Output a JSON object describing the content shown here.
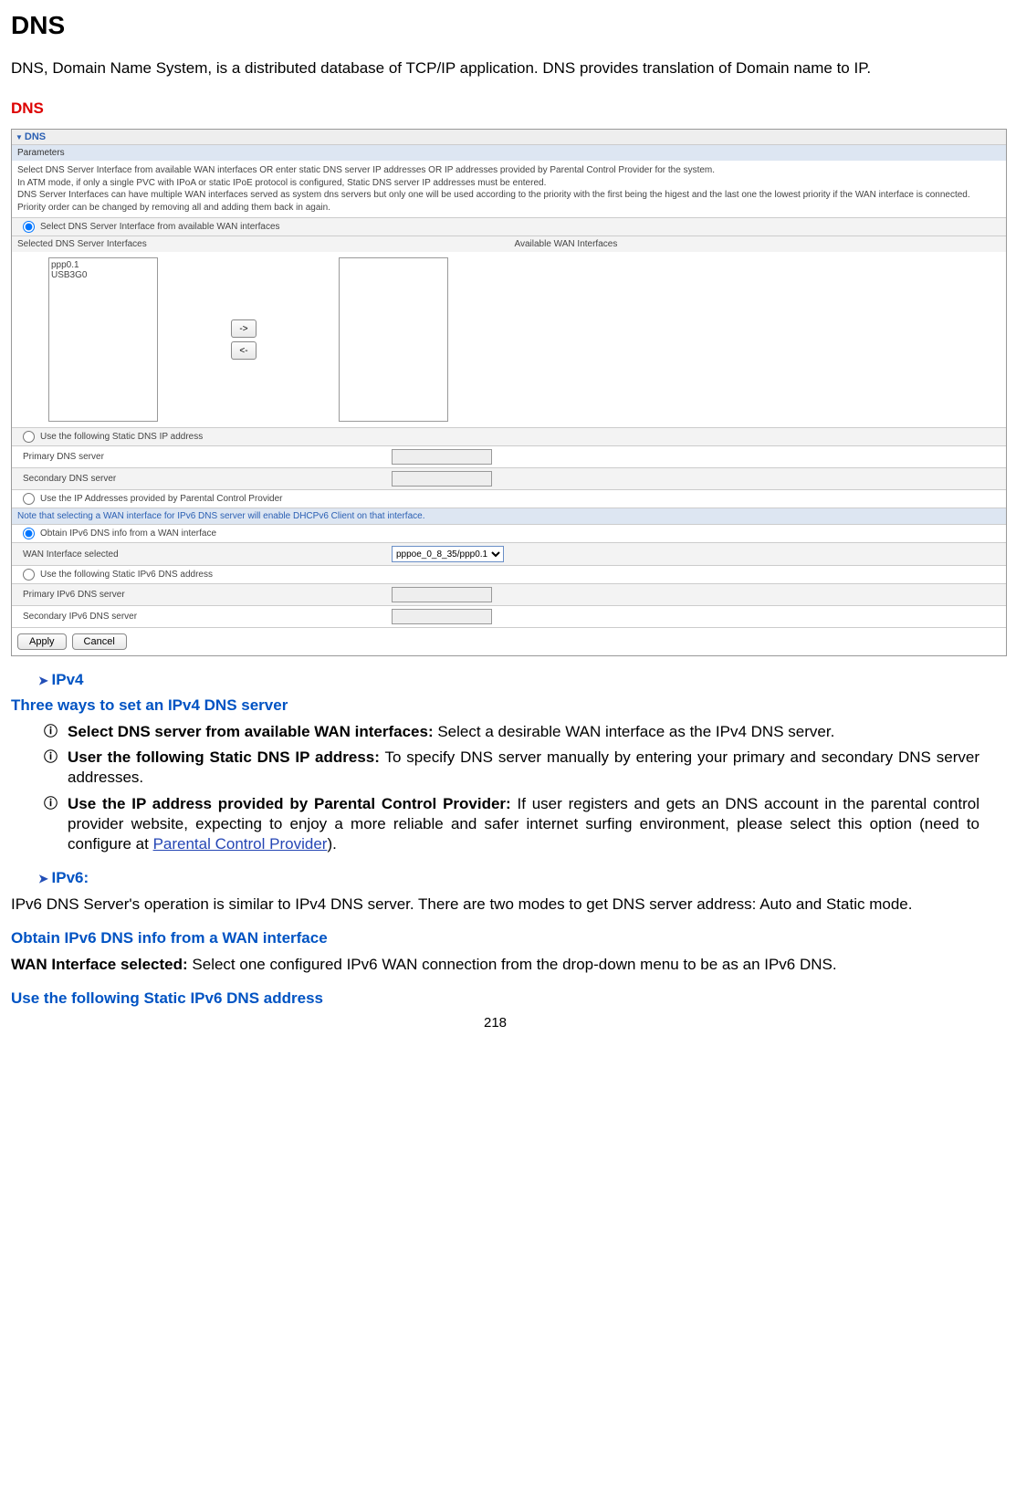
{
  "title": "DNS",
  "intro": "DNS, Domain Name System, is a distributed database of TCP/IP application. DNS provides translation of Domain name to IP.",
  "section_dns": "DNS",
  "panel": {
    "title": "DNS",
    "parameters": "Parameters",
    "desc1": "Select DNS Server Interface from available WAN interfaces OR enter static DNS server IP addresses OR IP addresses provided by Parental Control Provider for the system.",
    "desc2": "In ATM mode, if only a single PVC with IPoA or static IPoE protocol is configured, Static DNS server IP addresses must be entered.",
    "desc3": "DNS Server Interfaces can have multiple WAN interfaces served as system dns servers but only one will be used according to the priority with the first being the higest and the last one the lowest priority if the WAN interface is connected.",
    "desc4": "Priority order can be changed by removing all and adding them back in again.",
    "opt_select_wan": "Select DNS Server Interface from available WAN interfaces",
    "selected_head": "Selected DNS Server Interfaces",
    "available_head": "Available WAN Interfaces",
    "list_item_1": "ppp0.1",
    "list_item_2": "USB3G0",
    "btn_right": "->",
    "btn_left": "<-",
    "opt_static_dns": "Use the following Static DNS IP address",
    "primary_dns": "Primary DNS server",
    "secondary_dns": "Secondary DNS server",
    "opt_parental": "Use the IP Addresses provided by Parental Control Provider",
    "note_ipv6": "Note that selecting a WAN interface for IPv6 DNS server will enable DHCPv6 Client on that interface.",
    "opt_obtain_ipv6": "Obtain IPv6 DNS info from a WAN interface",
    "wan_iface_selected": "WAN Interface selected",
    "wan_select_option": "pppoe_0_8_35/ppp0.1",
    "opt_static_ipv6": "Use the following Static IPv6 DNS address",
    "primary_ipv6": "Primary IPv6 DNS server",
    "secondary_ipv6": "Secondary IPv6 DNS server",
    "btn_apply": "Apply",
    "btn_cancel": "Cancel"
  },
  "ipv4": {
    "head": "IPv4",
    "three_ways": "Three ways to set an IPv4 DNS server",
    "li1_bold": "Select DNS server from available WAN interfaces:",
    "li1_text": " Select a desirable WAN interface as the IPv4 DNS server.",
    "li2_bold": "User the following Static DNS IP address:",
    "li2_text": " To specify DNS server manually by entering your primary and secondary DNS server addresses.",
    "li3_bold": "Use the IP address provided by Parental Control Provider:",
    "li3_text_a": " If user registers and gets an DNS account in the parental control provider website, expecting to enjoy a more reliable and safer internet surfing environment, please select this option (need to configure at ",
    "li3_link": "Parental Control Provider",
    "li3_text_b": ")."
  },
  "ipv6": {
    "head": "IPv6:",
    "para": "IPv6 DNS Server's operation is similar to IPv4 DNS server. There are two modes to get DNS server address: Auto and Static mode.",
    "obtain_head": "Obtain IPv6 DNS info from a WAN interface",
    "wan_sel_bold": "WAN Interface selected:",
    "wan_sel_text": " Select one configured IPv6 WAN connection from the drop-down menu to be as an IPv6 DNS.",
    "static_head": "Use the following Static IPv6 DNS address"
  },
  "pageno": "218"
}
